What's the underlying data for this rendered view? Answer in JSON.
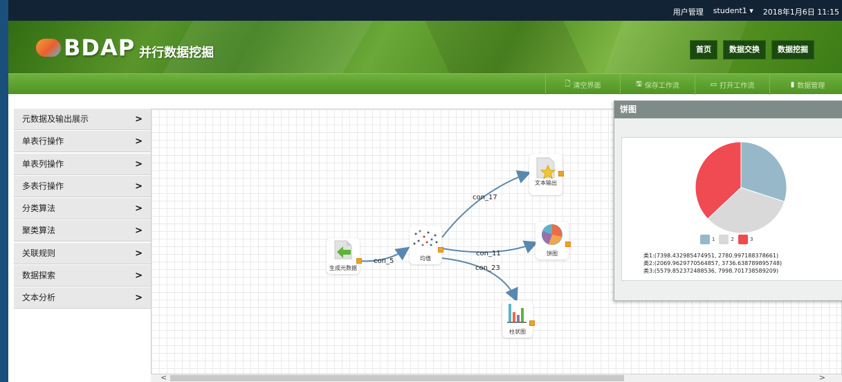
{
  "topbar": {
    "user_mgmt": "用户管理",
    "user": "student1",
    "datetime": "2018年1月6日 11:15"
  },
  "brand": {
    "logo": "BDAP",
    "subtitle": "并行数据挖掘"
  },
  "nav": [
    "首页",
    "数据交换",
    "数据挖掘"
  ],
  "toolbar": [
    {
      "icon": "file-icon",
      "label": "清空界面"
    },
    {
      "icon": "save-icon",
      "label": "保存工作流"
    },
    {
      "icon": "folder-open-icon",
      "label": "打开工作流"
    },
    {
      "icon": "document-icon",
      "label": "数据管理"
    }
  ],
  "sidebar": [
    "元数据及输出展示",
    "单表行操作",
    "单表列操作",
    "多表行操作",
    "分类算法",
    "聚类算法",
    "关联规则",
    "数据探索",
    "文本分析"
  ],
  "nodes": {
    "generate": "生成元数据",
    "mean": "均值",
    "text_output": "文本输出",
    "pie": "饼图",
    "bar": "柱状图"
  },
  "edges": {
    "e1": "con_5",
    "e2": "con_17",
    "e3": "con_11",
    "e4": "con_23"
  },
  "popup": {
    "title": "饼图",
    "legend": [
      "1",
      "2",
      "3"
    ],
    "stats": [
      "类1:(7398.432985474951, 2780.997188378661)",
      "类2:(2069.9629770564857, 3736.638789895748)",
      "类3:(5579.852372488536, 7998.701738589209)"
    ]
  },
  "chart_data": {
    "type": "pie",
    "categories": [
      "1",
      "2",
      "3"
    ],
    "values": [
      30,
      33,
      37
    ],
    "colors": [
      "#96b8c9",
      "#d9d9d9",
      "#f04a52"
    ]
  }
}
